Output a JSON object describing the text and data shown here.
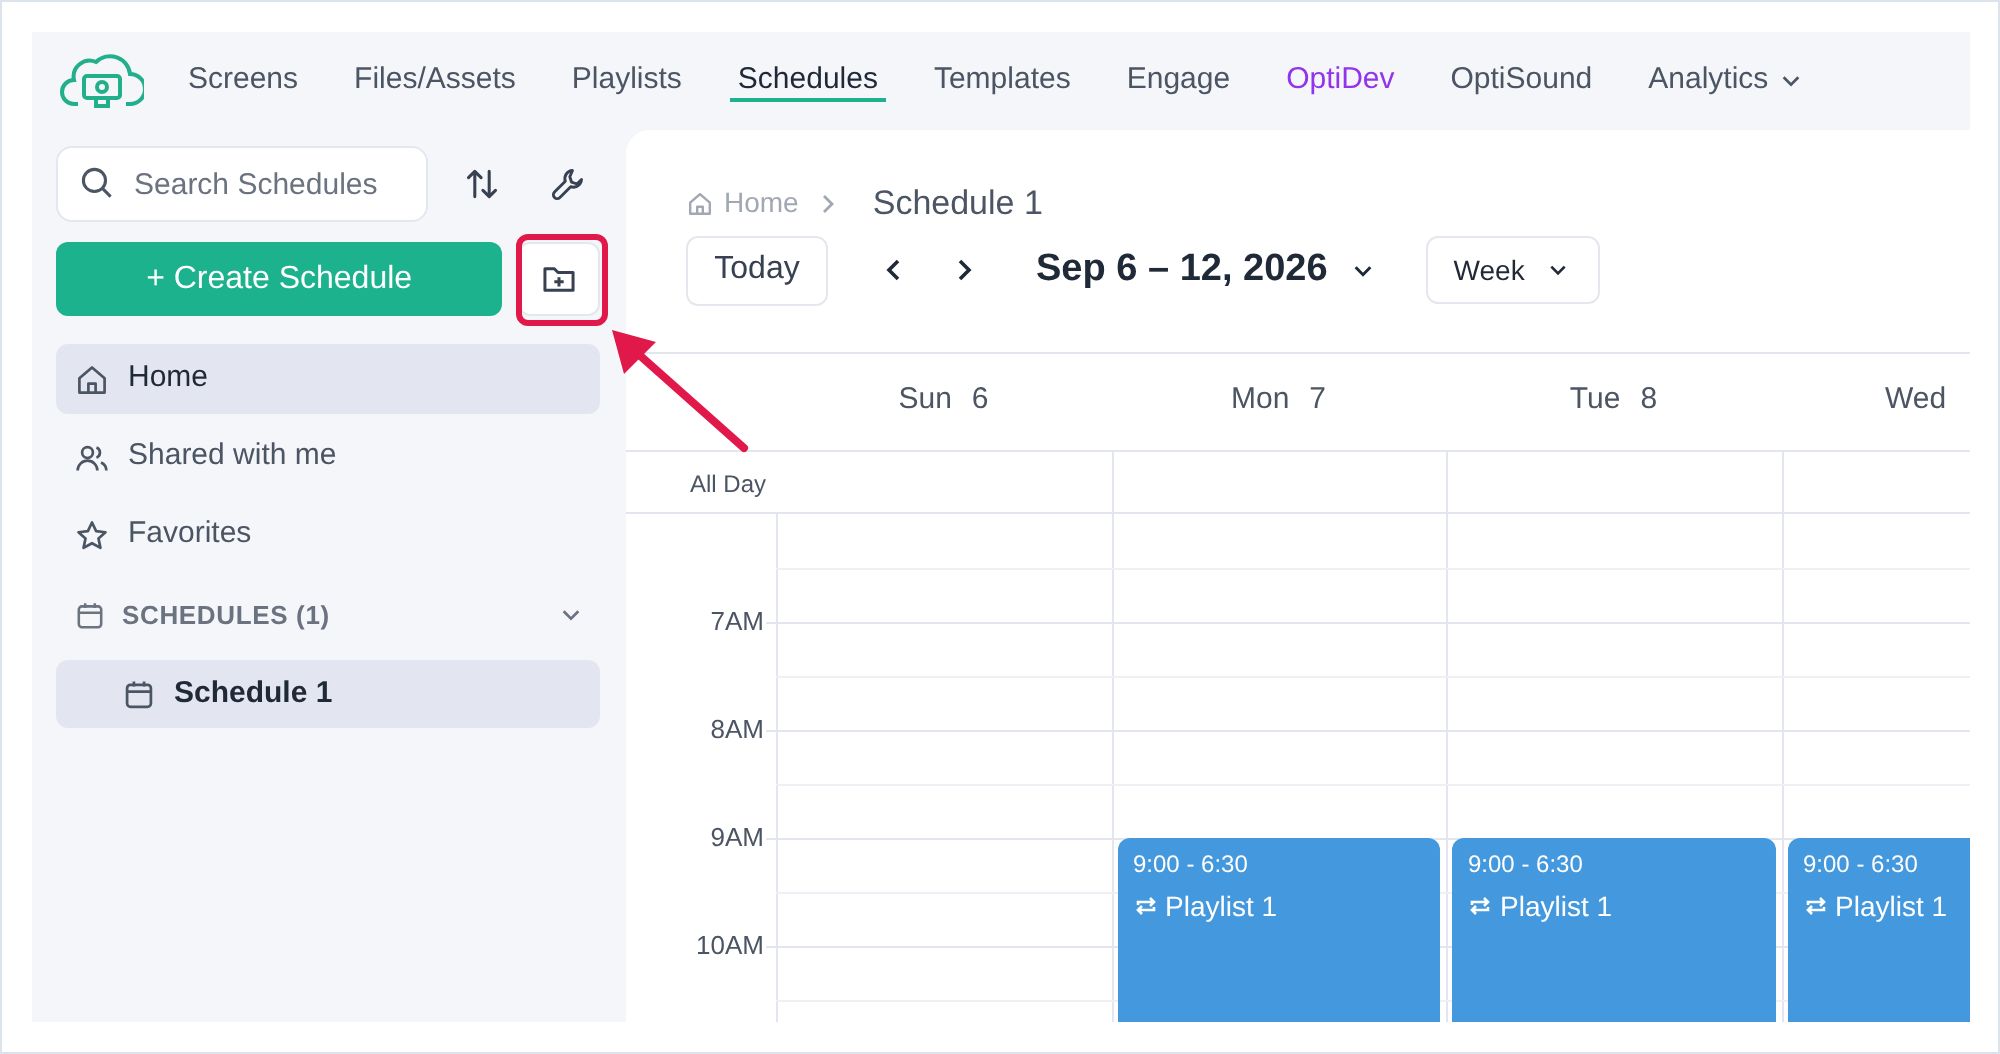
{
  "nav": {
    "items": [
      {
        "label": "Screens",
        "selected": false,
        "kind": "plain"
      },
      {
        "label": "Files/Assets",
        "selected": false,
        "kind": "plain"
      },
      {
        "label": "Playlists",
        "selected": false,
        "kind": "plain"
      },
      {
        "label": "Schedules",
        "selected": true,
        "kind": "plain"
      },
      {
        "label": "Templates",
        "selected": false,
        "kind": "plain"
      },
      {
        "label": "Engage",
        "selected": false,
        "kind": "plain"
      },
      {
        "label": "OptiDev",
        "selected": false,
        "kind": "promo"
      },
      {
        "label": "OptiSound",
        "selected": false,
        "kind": "plain"
      },
      {
        "label": "Analytics",
        "selected": false,
        "kind": "menu"
      }
    ]
  },
  "sidebar": {
    "search": {
      "placeholder": "Search Schedules"
    },
    "create_button": "+ Create Schedule",
    "items": [
      {
        "label": "Home",
        "selected": true,
        "kind": "home"
      },
      {
        "label": "Shared with me",
        "selected": false,
        "kind": "people"
      },
      {
        "label": "Favorites",
        "selected": false,
        "kind": "star"
      }
    ],
    "section": {
      "label": "SCHEDULES (1)",
      "expanded": true,
      "children": [
        {
          "label": "Schedule 1",
          "selected": true
        }
      ]
    }
  },
  "breadcrumb": {
    "home": "Home",
    "current": "Schedule 1"
  },
  "toolbar": {
    "today": "Today",
    "range": "Sep 6 – 12, 2026",
    "view": "Week"
  },
  "calendar": {
    "all_day": "All Day",
    "days": [
      {
        "name": "Sun",
        "date": "6"
      },
      {
        "name": "Mon",
        "date": "7",
        "events": [
          {
            "time": "9:00 - 6:30",
            "title": "Playlist 1"
          }
        ]
      },
      {
        "name": "Tue",
        "date": "8",
        "events": [
          {
            "time": "9:00 - 6:30",
            "title": "Playlist 1"
          }
        ]
      },
      {
        "name": "Wed",
        "events": [
          {
            "time": "9:00 - 6:30",
            "title": "Playlist 1"
          }
        ]
      }
    ],
    "hours": [
      "7AM",
      "8AM",
      "9AM",
      "10AM"
    ]
  }
}
